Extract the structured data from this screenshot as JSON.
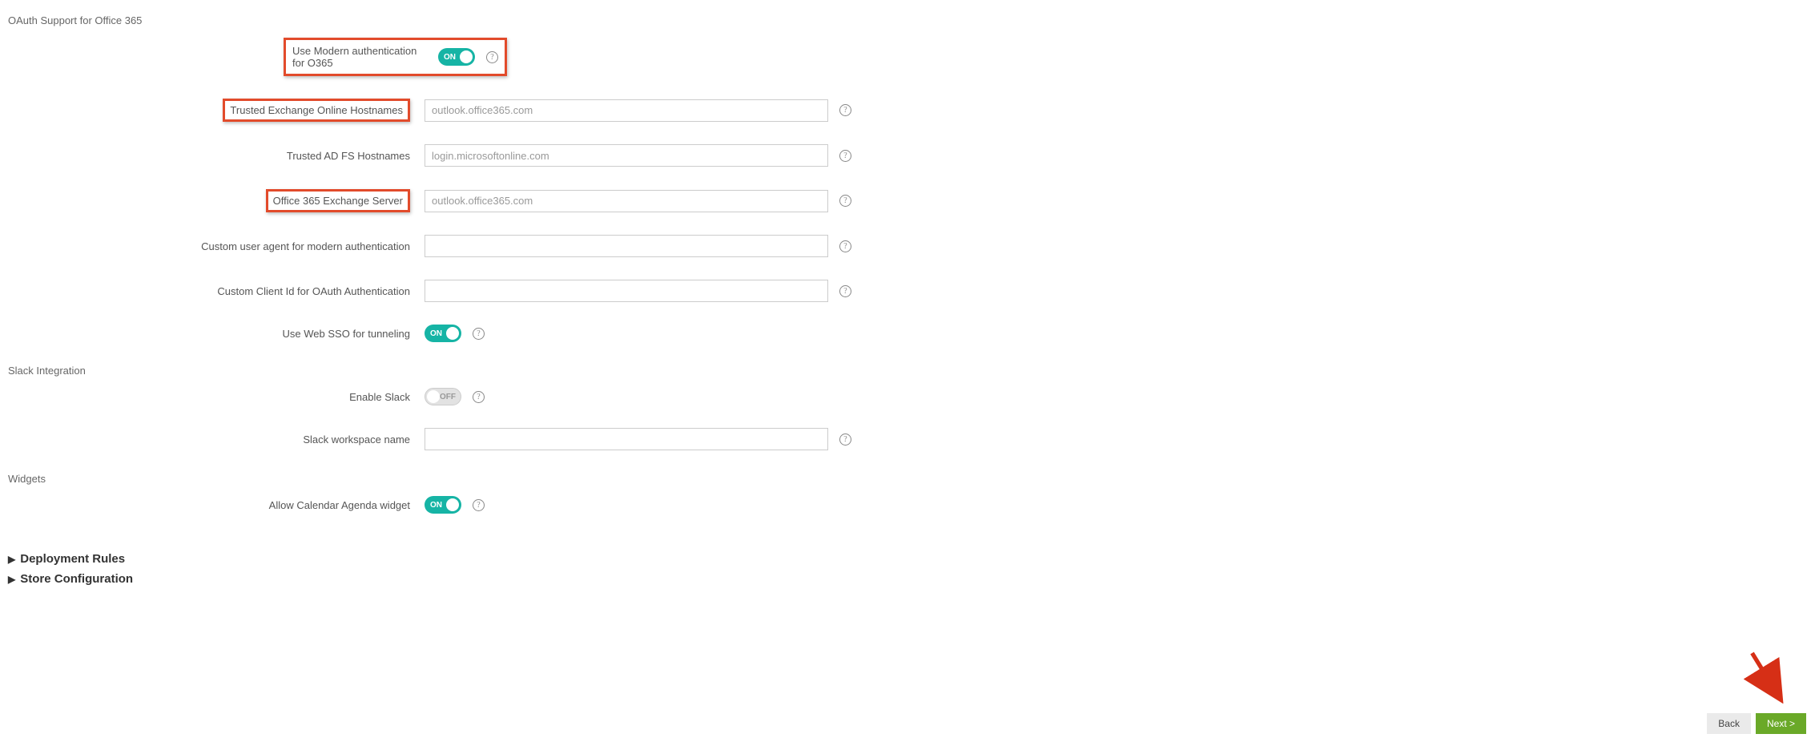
{
  "sections": {
    "oauth": "OAuth Support for Office 365",
    "slack": "Slack Integration",
    "widgets": "Widgets"
  },
  "labels": {
    "modern_auth": "Use Modern authentication for O365",
    "trusted_exchange": "Trusted Exchange Online Hostnames",
    "trusted_adfs": "Trusted AD FS Hostnames",
    "o365_server": "Office 365 Exchange Server",
    "custom_ua": "Custom user agent for modern authentication",
    "custom_client": "Custom Client Id for OAuth Authentication",
    "web_sso": "Use Web SSO for tunneling",
    "enable_slack": "Enable Slack",
    "slack_ws": "Slack workspace name",
    "calendar_widget": "Allow Calendar Agenda widget"
  },
  "placeholders": {
    "trusted_exchange": "outlook.office365.com",
    "trusted_adfs": "login.microsoftonline.com",
    "o365_server": "outlook.office365.com"
  },
  "toggle": {
    "on": "ON",
    "off": "OFF"
  },
  "expanders": {
    "deploy": "Deployment Rules",
    "store": "Store Configuration"
  },
  "buttons": {
    "back": "Back",
    "next": "Next >"
  },
  "help": "?"
}
